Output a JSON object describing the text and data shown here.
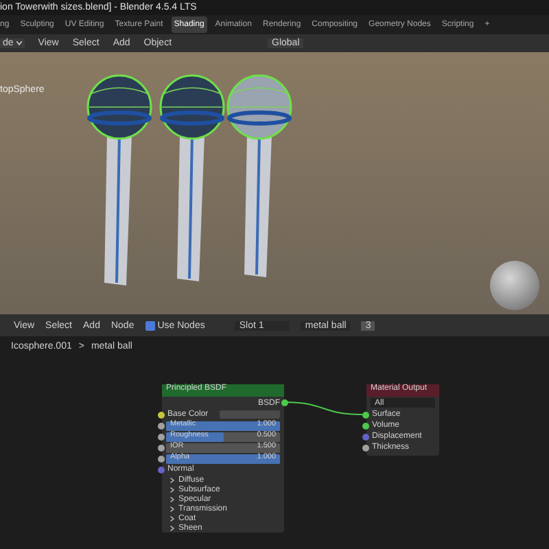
{
  "window": {
    "title": "ion Towerwith sizes.blend] - Blender 4.5.4 LTS"
  },
  "tabs": [
    {
      "label": "ng",
      "selected": false
    },
    {
      "label": "Sculpting",
      "selected": false
    },
    {
      "label": "UV Editing",
      "selected": false
    },
    {
      "label": "Texture Paint",
      "selected": false
    },
    {
      "label": "Shading",
      "selected": true
    },
    {
      "label": "Animation",
      "selected": false
    },
    {
      "label": "Rendering",
      "selected": false
    },
    {
      "label": "Compositing",
      "selected": false
    },
    {
      "label": "Geometry Nodes",
      "selected": false
    },
    {
      "label": "Scripting",
      "selected": false
    },
    {
      "label": "+",
      "selected": false
    }
  ],
  "viewport_header": {
    "mode": "de",
    "menus": [
      "View",
      "Select",
      "Add",
      "Object"
    ],
    "orientation": "Global"
  },
  "viewport": {
    "object_label": "topSphere"
  },
  "node_header": {
    "menus": [
      "View",
      "Select",
      "Add",
      "Node"
    ],
    "use_nodes": {
      "label": "Use Nodes",
      "checked": true
    },
    "slot": "Slot 1",
    "material": "metal ball",
    "users": "3"
  },
  "breadcrumb": {
    "object": "Icosphere.001",
    "separator": ">",
    "material": "metal ball"
  },
  "principled": {
    "title": "Principled BSDF",
    "output": {
      "label": "BSDF",
      "color": "#4cc94c"
    },
    "inputs": [
      {
        "kind": "color",
        "label": "Base Color",
        "color": "#c7c73a"
      },
      {
        "kind": "slider",
        "label": "Metallic",
        "value": "1.000",
        "level": 1,
        "color": "#a1a1a1"
      },
      {
        "kind": "slider",
        "label": "Roughness",
        "value": "0.500",
        "level": 0.5,
        "color": "#a1a1a1"
      },
      {
        "kind": "number",
        "label": "IOR",
        "value": "1.500",
        "color": "#a1a1a1"
      },
      {
        "kind": "slider",
        "label": "Alpha",
        "value": "1.000",
        "level": 1,
        "color": "#a1a1a1"
      },
      {
        "kind": "vector",
        "label": "Normal",
        "color": "#6363c7"
      }
    ],
    "panels": [
      "Diffuse",
      "Subsurface",
      "Specular",
      "Transmission",
      "Coat",
      "Sheen"
    ]
  },
  "material_output": {
    "title": "Material Output",
    "target": "All",
    "inputs": [
      {
        "label": "Surface",
        "color": "#4cc94c"
      },
      {
        "label": "Volume",
        "color": "#4cc94c"
      },
      {
        "label": "Displacement",
        "color": "#6363c7"
      },
      {
        "label": "Thickness",
        "color": "#a1a1a1"
      }
    ]
  }
}
